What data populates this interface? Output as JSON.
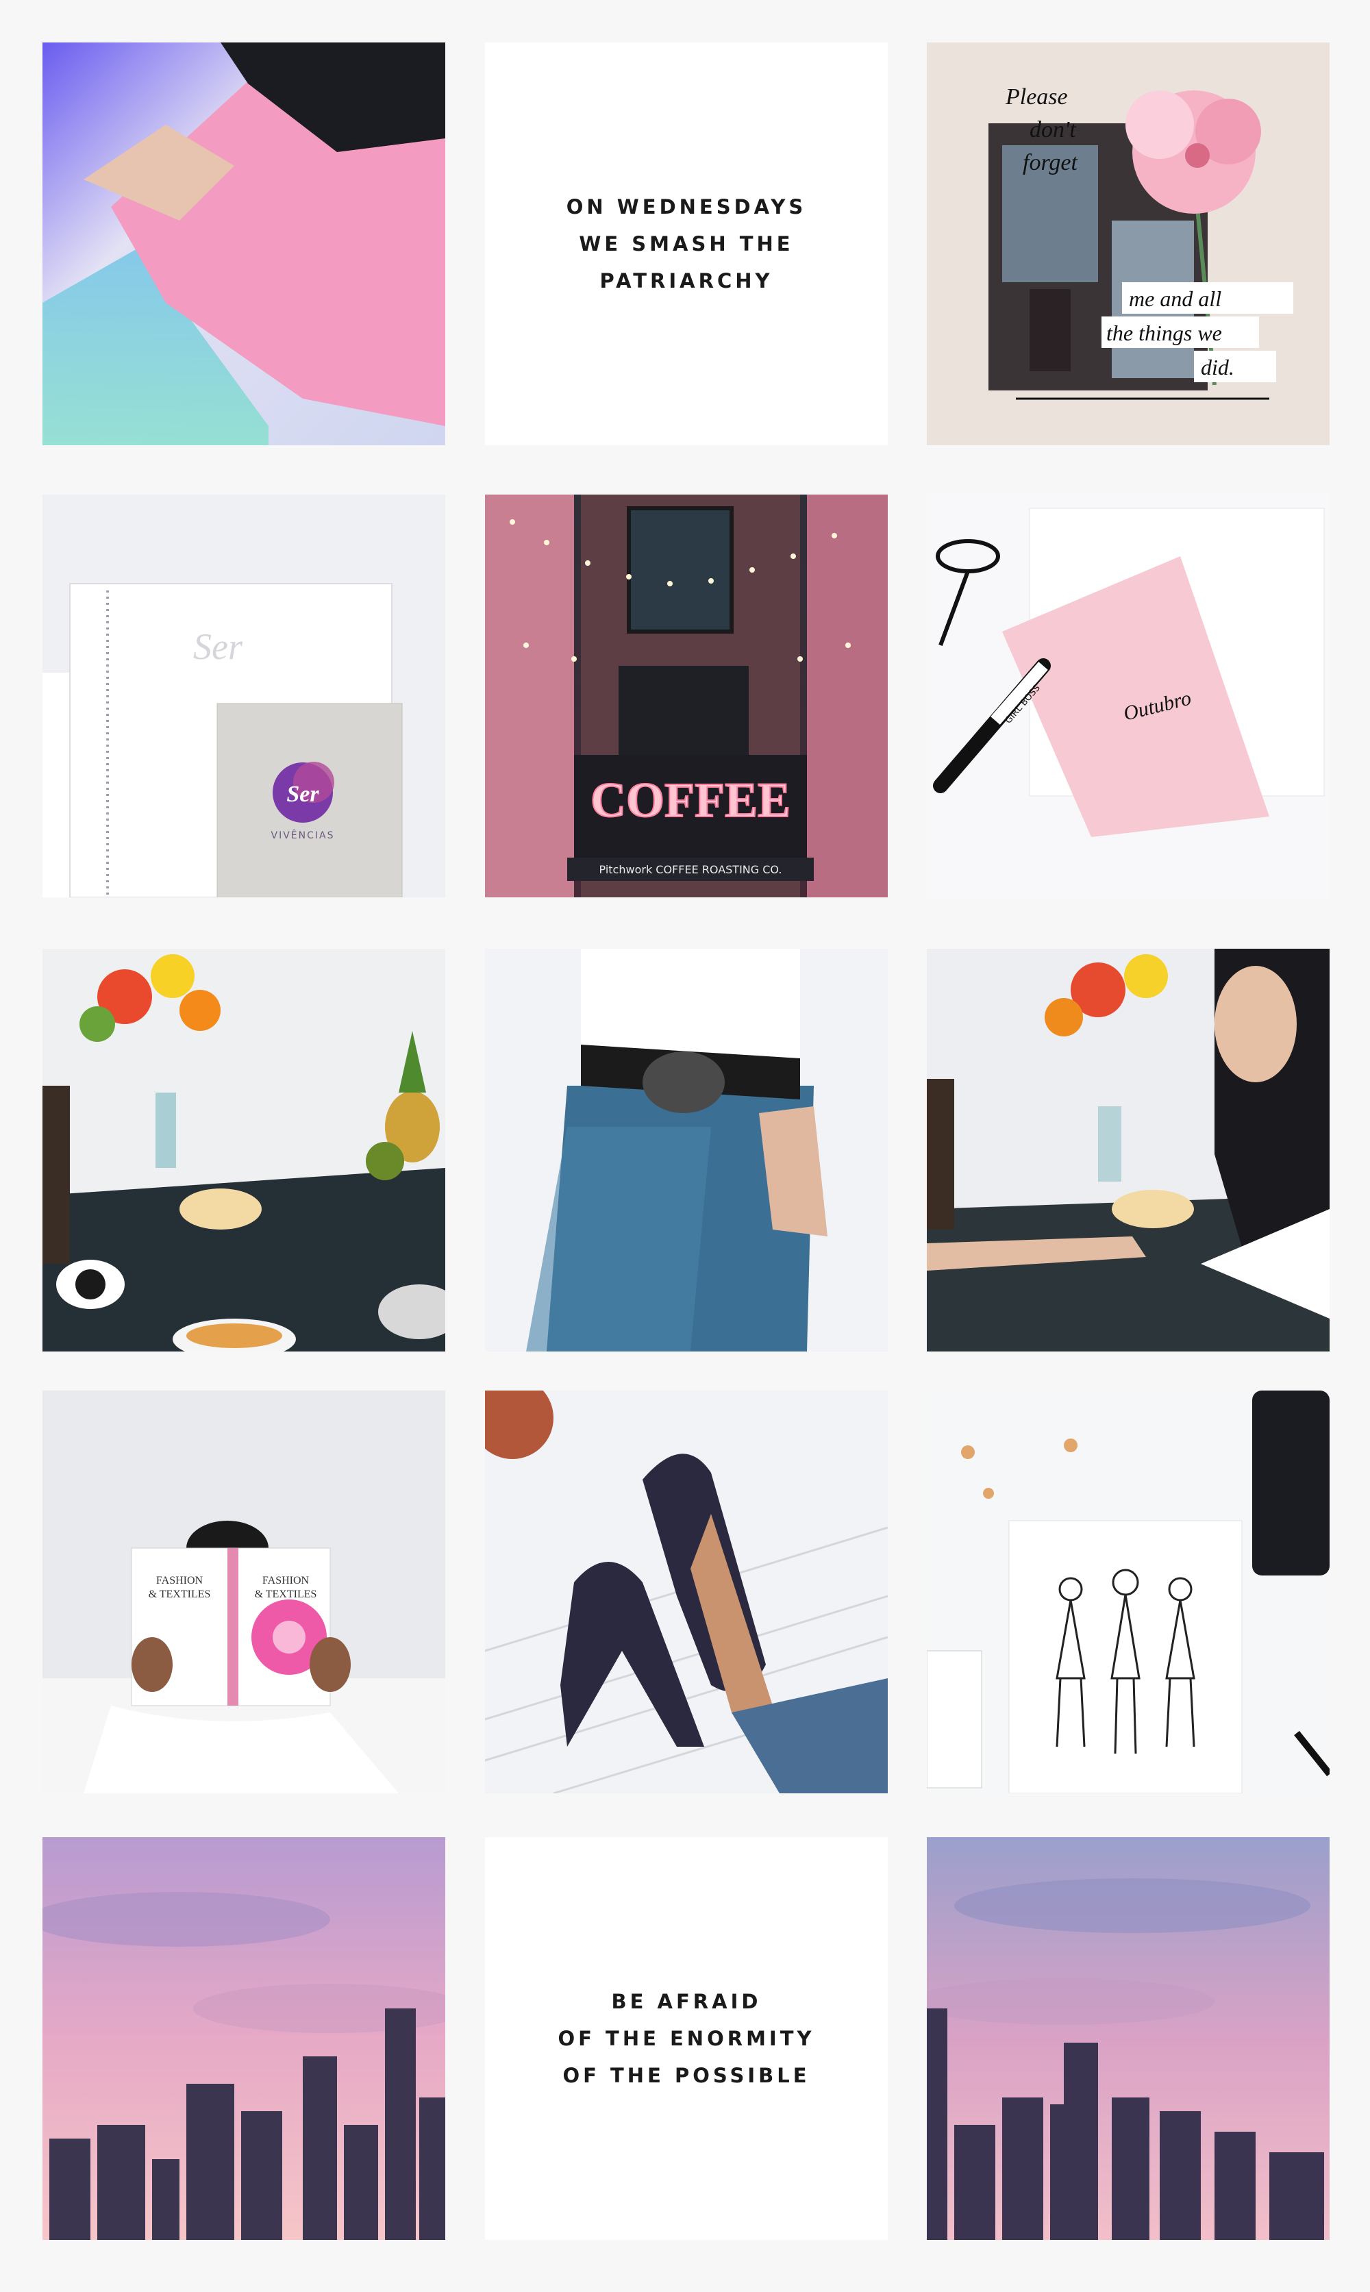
{
  "quotes": {
    "wednesday": [
      "ON WEDNESDAYS",
      "WE SMASH THE",
      "PATRIARCHY"
    ],
    "afraid": [
      "BE AFRAID",
      "OF THE ENORMITY",
      "OF THE POSSIBLE"
    ]
  },
  "collage": {
    "line1": "Please",
    "line2": "don't",
    "line3": "forget",
    "line4": "me and all",
    "line5": "the things we",
    "line6": "did."
  },
  "notebook": {
    "cover_script": "Ser",
    "badge_text": "Ser",
    "badge_sub": "VIVÊNCIAS"
  },
  "coffee": {
    "sign": "COFFEE",
    "awning": "Pitchwork COFFEE ROASTING CO."
  },
  "card": {
    "script": "Outubro",
    "pen_text": "GIRL BOSS"
  },
  "book": {
    "title_line1": "FASHION",
    "title_line2": "& TEXTILES"
  },
  "colors": {
    "page_bg": "#f7f7f8",
    "quote_bg": "#ffffff",
    "quote_text": "#1a1a1a",
    "accent_pink": "#f4a7c2"
  },
  "icons": [
    "flower-icon",
    "pineapple-icon",
    "shoe-icon",
    "pen-icon",
    "glasses-icon"
  ]
}
